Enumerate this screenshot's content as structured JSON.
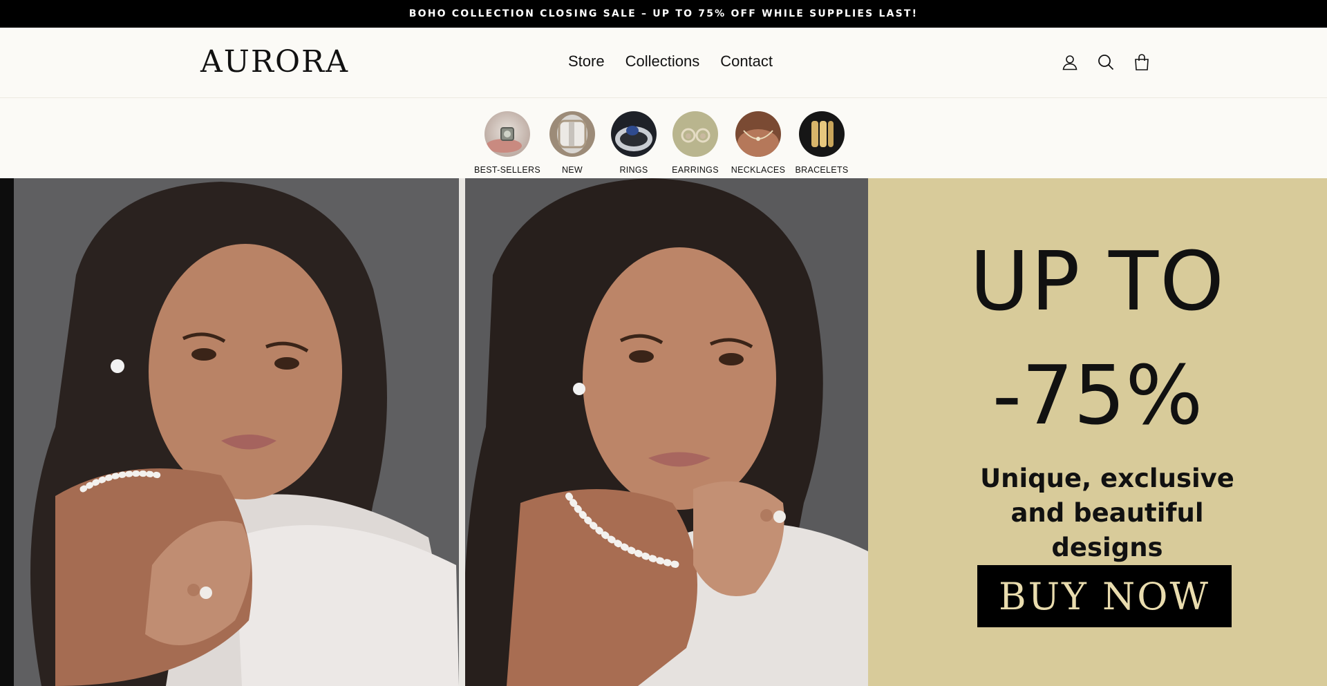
{
  "announcement": "BOHO COLLECTION CLOSING SALE – UP TO 75% OFF WHILE SUPPLIES LAST!",
  "header": {
    "logo": "AURORA",
    "nav": [
      "Store",
      "Collections",
      "Contact"
    ],
    "icons": [
      "account-icon",
      "search-icon",
      "cart-icon"
    ]
  },
  "categories": [
    {
      "label": "BEST-SELLERS",
      "icon": "ring-thumbnail"
    },
    {
      "label": "NEW",
      "icon": "cuff-ring-thumbnail"
    },
    {
      "label": "RINGS",
      "icon": "sapphire-ring-thumbnail"
    },
    {
      "label": "EARRINGS",
      "icon": "earrings-thumbnail"
    },
    {
      "label": "NECKLACES",
      "icon": "necklace-thumbnail"
    },
    {
      "label": "BRACELETS",
      "icon": "bracelet-thumbnail"
    }
  ],
  "hero": {
    "promo_line1": "UP TO",
    "promo_line2": "-75%",
    "promo_text": "Unique, exclusive and beautiful designs",
    "cta": "BUY NOW",
    "colors": {
      "promo_bg": "#d8cb9a",
      "cta_text": "#e9dcae"
    }
  }
}
